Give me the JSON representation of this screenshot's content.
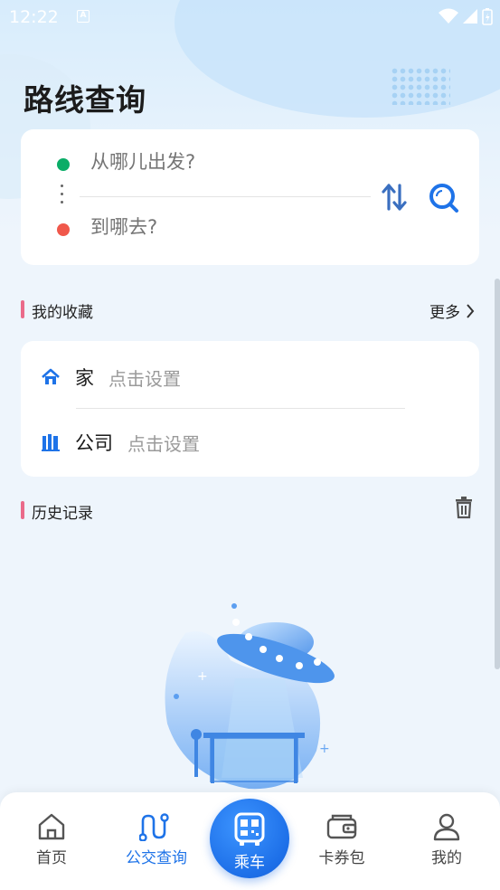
{
  "status_bar": {
    "time": "12:22",
    "notification_badge": "A"
  },
  "page_title": "路线查询",
  "route_search": {
    "from_placeholder": "从哪儿出发?",
    "to_placeholder": "到哪去?",
    "from_dot_color": "#0aad67",
    "to_dot_color": "#f0584b"
  },
  "favorites": {
    "title": "我的收藏",
    "more_label": "更多",
    "items": [
      {
        "name": "家",
        "hint": "点击设置",
        "icon": "home-icon"
      },
      {
        "name": "公司",
        "hint": "点击设置",
        "icon": "building-icon"
      }
    ]
  },
  "history": {
    "title": "历史记录"
  },
  "bottom_nav": {
    "items": [
      {
        "label": "首页",
        "icon": "home-outline-icon"
      },
      {
        "label": "公交查询",
        "icon": "route-icon",
        "active": true
      },
      {
        "label": "乘车",
        "icon": "qr-bus-icon"
      },
      {
        "label": "卡券包",
        "icon": "wallet-icon"
      },
      {
        "label": "我的",
        "icon": "user-icon"
      }
    ]
  },
  "colors": {
    "accent": "#1e73e8",
    "section_bar": "#ea6b8a"
  }
}
